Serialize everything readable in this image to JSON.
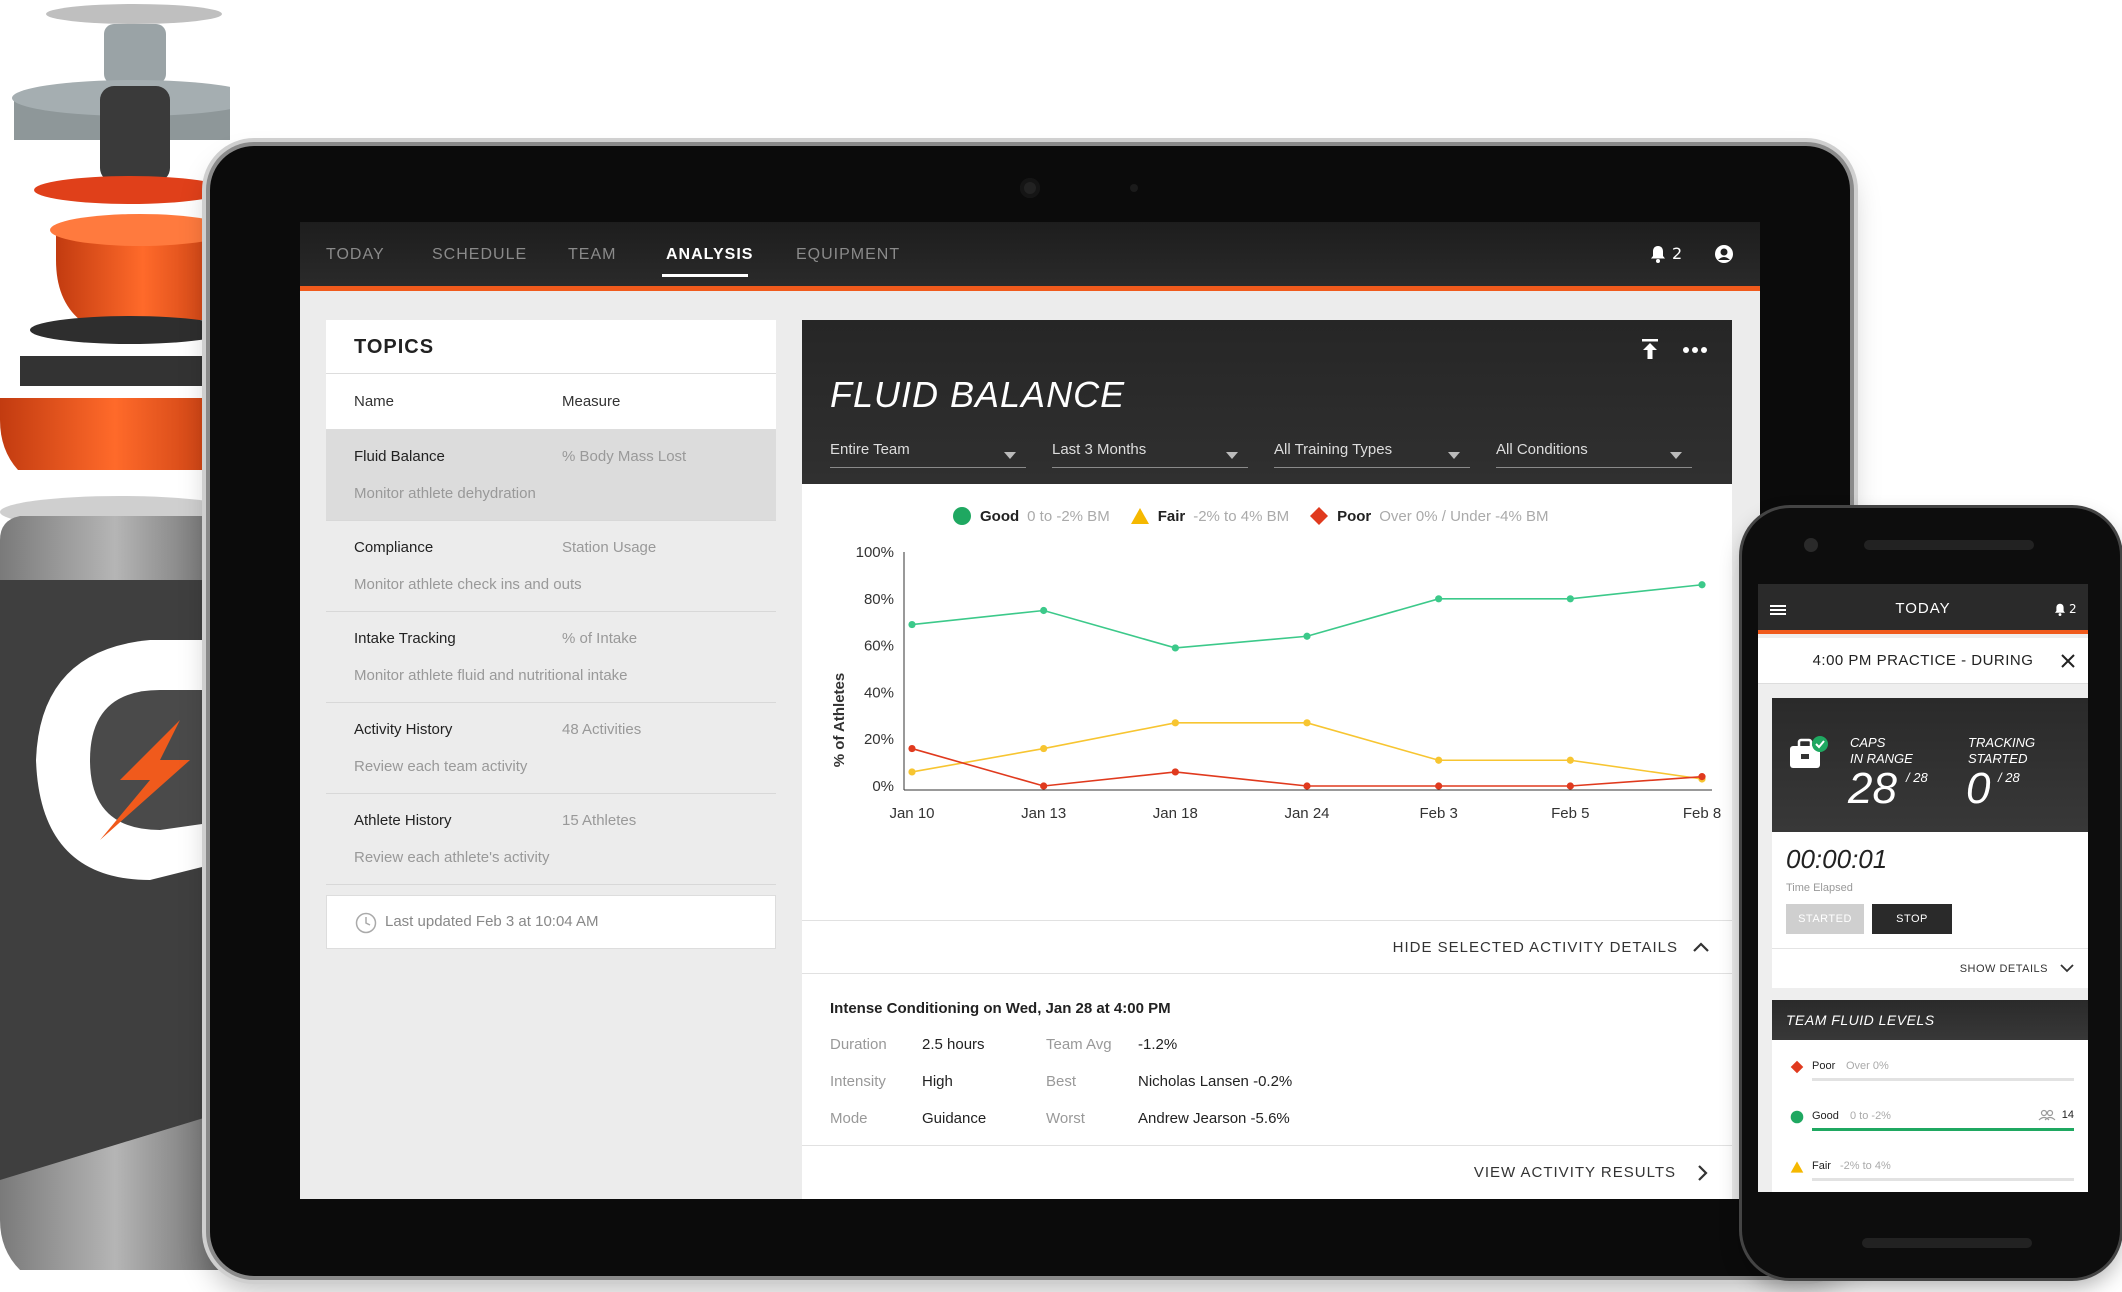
{
  "nav": {
    "items": [
      {
        "label": "TODAY",
        "active": false
      },
      {
        "label": "SCHEDULE",
        "active": false
      },
      {
        "label": "TEAM",
        "active": false
      },
      {
        "label": "ANALYSIS",
        "active": true
      },
      {
        "label": "EQUIPMENT",
        "active": false
      }
    ],
    "notification_count": "2"
  },
  "topics": {
    "title": "TOPICS",
    "col_name": "Name",
    "col_measure": "Measure",
    "rows": [
      {
        "name": "Fluid Balance",
        "measure": "% Body Mass Lost",
        "desc": "Monitor athlete dehydration",
        "selected": true
      },
      {
        "name": "Compliance",
        "measure": "Station Usage",
        "desc": "Monitor athlete check ins and outs",
        "selected": false
      },
      {
        "name": "Intake Tracking",
        "measure": "% of Intake",
        "desc": "Monitor athlete fluid and nutritional intake",
        "selected": false
      },
      {
        "name": "Activity History",
        "measure": "48 Activities",
        "desc": "Review each team activity",
        "selected": false
      },
      {
        "name": "Athlete History",
        "measure": "15 Athletes",
        "desc": "Review each athlete's activity",
        "selected": false
      }
    ],
    "last_updated": "Last updated Feb 3 at 10:04 AM"
  },
  "card": {
    "title": "FLUID BALANCE",
    "filters": [
      "Entire Team",
      "Last 3 Months",
      "All Training Types",
      "All Conditions"
    ],
    "legend": [
      {
        "name": "Good",
        "range": "0 to -2% BM",
        "color": "#1fa861",
        "shape": "circle"
      },
      {
        "name": "Fair",
        "range": "-2% to 4% BM",
        "color": "#f5b800",
        "shape": "triangle"
      },
      {
        "name": "Poor",
        "range": "Over 0% / Under -4% BM",
        "color": "#e03a1e",
        "shape": "diamond"
      }
    ],
    "hide_details": "HIDE SELECTED ACTIVITY DETAILS",
    "details": {
      "title": "Intense Conditioning on Wed, Jan 28 at 4:00 PM",
      "duration_label": "Duration",
      "duration": "2.5 hours",
      "intensity_label": "Intensity",
      "intensity": "High",
      "mode_label": "Mode",
      "mode": "Guidance",
      "team_avg_label": "Team Avg",
      "team_avg": "-1.2%",
      "best_label": "Best",
      "best": "Nicholas Lansen -0.2%",
      "worst_label": "Worst",
      "worst": "Andrew Jearson -5.6%"
    },
    "view_results": "VIEW ACTIVITY RESULTS"
  },
  "chart_data": {
    "type": "line",
    "categories": [
      "Jan 10",
      "Jan 13",
      "Jan 18",
      "Jan 24",
      "Feb 3",
      "Feb 5",
      "Feb 8"
    ],
    "ylabel": "% of Athletes",
    "ylim": [
      0,
      100
    ],
    "yticks": [
      "0%",
      "20%",
      "40%",
      "60%",
      "80%",
      "100%"
    ],
    "grid": false,
    "legend_position": "top",
    "series": [
      {
        "name": "Good",
        "color": "#3cc98a",
        "values": [
          69,
          75,
          59,
          64,
          80,
          80,
          86
        ]
      },
      {
        "name": "Fair",
        "color": "#f7c531",
        "values": [
          6,
          16,
          27,
          27,
          11,
          11,
          3
        ]
      },
      {
        "name": "Poor",
        "color": "#e03a1e",
        "values": [
          16,
          0,
          6,
          0,
          0,
          0,
          4
        ]
      }
    ]
  },
  "phone": {
    "title": "TODAY",
    "notification_count": "2",
    "session": "4:00 PM PRACTICE - DURING",
    "caps_label_1": "CAPS",
    "caps_label_2": "IN RANGE",
    "caps_value": "28",
    "caps_of": "/ 28",
    "tracking_label_1": "TRACKING",
    "tracking_label_2": "STARTED",
    "tracking_value": "0",
    "tracking_of": "/ 28",
    "timer": "00:00:01",
    "timer_label": "Time Elapsed",
    "started_label": "STARTED",
    "stop_label": "STOP",
    "show_details": "SHOW DETAILS",
    "levels_title": "TEAM FLUID LEVELS",
    "levels": [
      {
        "name": "Poor",
        "range": "Over 0%",
        "color": "#e03a1e",
        "shape": "diamond",
        "count": "",
        "fill": 0
      },
      {
        "name": "Good",
        "range": "0 to -2%",
        "color": "#1fa861",
        "shape": "circle",
        "count": "14",
        "fill": 1
      },
      {
        "name": "Fair",
        "range": "-2% to 4%",
        "color": "#f5b800",
        "shape": "triangle",
        "count": "",
        "fill": 0
      }
    ]
  }
}
